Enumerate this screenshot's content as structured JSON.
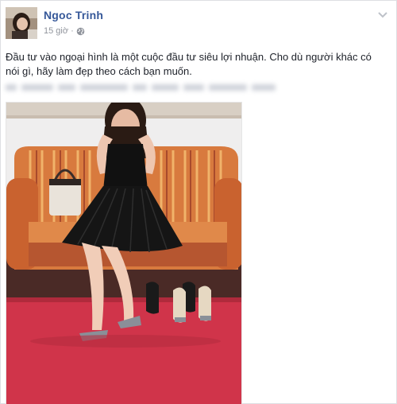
{
  "post": {
    "author_name": "Ngoc Trinh",
    "time_label": "15 giờ",
    "separator": "·",
    "privacy_icon": "globe-icon",
    "options_icon": "chevron-down-icon",
    "text": "Đầu tư vào ngoại hình là một cuộc đầu tư siêu lợi nhuận. Cho dù người khác có nói gì, hãy làm đẹp theo cách bạn muốn.",
    "colors": {
      "author": "#365899",
      "meta": "#90949c",
      "text": "#1d2129"
    }
  }
}
